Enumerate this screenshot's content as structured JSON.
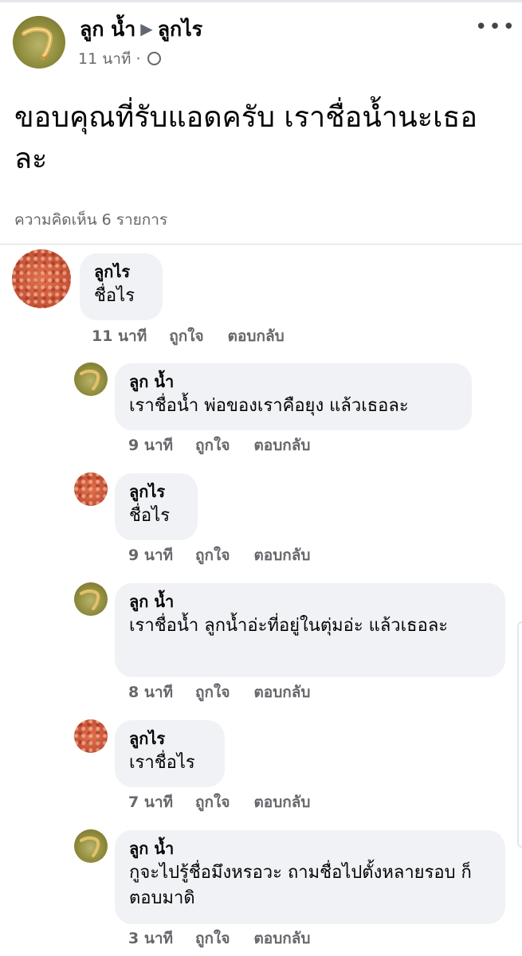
{
  "post": {
    "author": "ลูก น้ำ",
    "target": "ลูกไร",
    "time": "11 นาที",
    "text": "ขอบคุณที่รับแอดครับ  เราชื่อน้ำนะเธอละ",
    "comment_count": "ความคิดเห็น 6 รายการ"
  },
  "icons": {
    "more": "more-options-icon",
    "audience": "globe-icon",
    "arrow": "triangle-right-icon"
  },
  "colors": {
    "bubble": "#f0f2f5",
    "meta": "#65676b"
  },
  "comments": [
    {
      "name": "ลูกไร",
      "text": "ชื่อไร",
      "time": "11 นาที",
      "like": "ถูกใจ",
      "reply": "ตอบกลับ"
    },
    {
      "name": "ลูก น้ำ",
      "text": "เราชื่อน้ำ พ่อของเราคือยุง แล้วเธอละ",
      "time": "9 นาที",
      "like": "ถูกใจ",
      "reply": "ตอบกลับ"
    },
    {
      "name": "ลูกไร",
      "text": "ชื่อไร",
      "time": "9 นาที",
      "like": "ถูกใจ",
      "reply": "ตอบกลับ"
    },
    {
      "name": "ลูก น้ำ",
      "text": "เราชื่อน้ำ ลูกน้ำอ่ะที่อยู่ในตุ่มอ่ะ แล้วเธอละ",
      "time": "8 นาที",
      "like": "ถูกใจ",
      "reply": "ตอบกลับ"
    },
    {
      "name": "ลูกไร",
      "text": "เราชื่อไร",
      "time": "7 นาที",
      "like": "ถูกใจ",
      "reply": "ตอบกลับ"
    },
    {
      "name": "ลูก น้ำ",
      "text": "กูจะไปรู้ชื่อมึงหรอวะ  ถามชื่อไปตั้งหลายรอบ ก็ตอบมาดิ",
      "time": "3 นาที",
      "like": "ถูกใจ",
      "reply": "ตอบกลับ"
    }
  ]
}
